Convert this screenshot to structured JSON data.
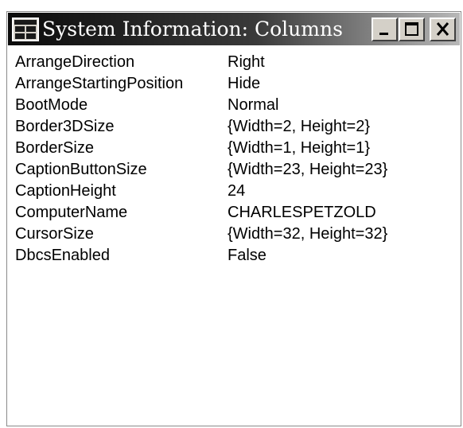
{
  "window": {
    "title": "System Information: Columns",
    "icon": "app-window-icon",
    "buttons": {
      "minimize": "minimize-icon",
      "maximize": "maximize-icon",
      "close": "close-icon"
    }
  },
  "properties": [
    {
      "name": "ArrangeDirection",
      "value": "Right"
    },
    {
      "name": "ArrangeStartingPosition",
      "value": "Hide"
    },
    {
      "name": "BootMode",
      "value": "Normal"
    },
    {
      "name": "Border3DSize",
      "value": "{Width=2,  Height=2}"
    },
    {
      "name": "BorderSize",
      "value": "{Width=1,  Height=1}"
    },
    {
      "name": "CaptionButtonSize",
      "value": "{Width=23,  Height=23}"
    },
    {
      "name": "CaptionHeight",
      "value": "24"
    },
    {
      "name": "ComputerName",
      "value": "CHARLESPETZOLD"
    },
    {
      "name": "CursorSize",
      "value": "{Width=32,  Height=32}"
    },
    {
      "name": "DbcsEnabled",
      "value": "False"
    }
  ]
}
